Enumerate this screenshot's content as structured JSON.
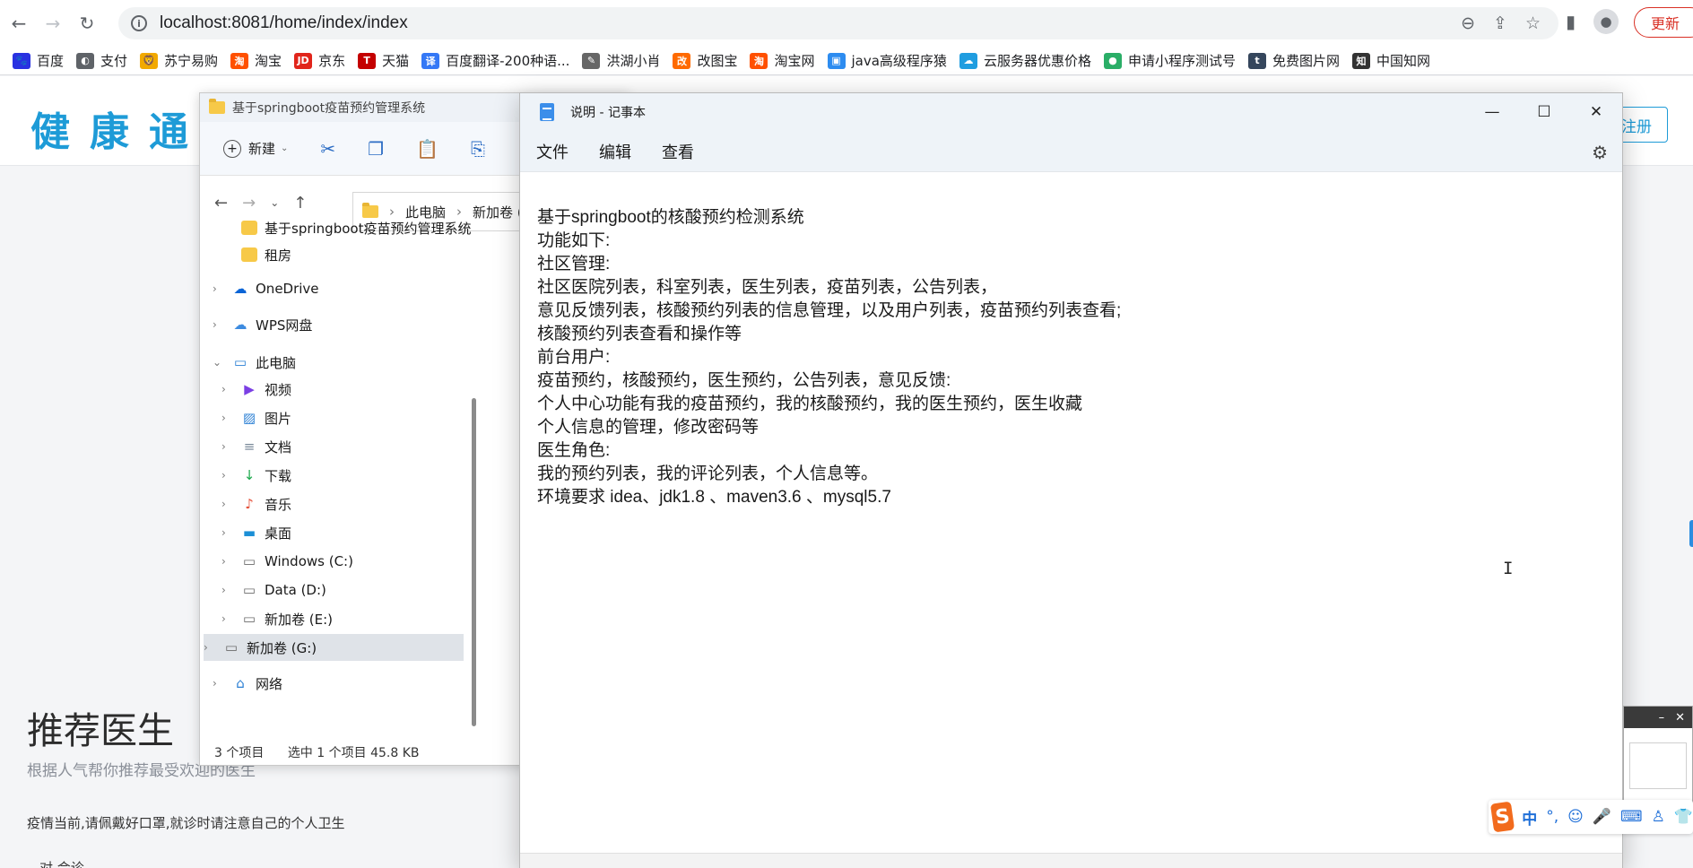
{
  "browser": {
    "url": "localhost:8081/home/index/index",
    "update_label": "更新",
    "bookmarks": [
      {
        "label": "百度",
        "icon": "baidu-icon",
        "color": "#2932e1",
        "glyph": "🐾"
      },
      {
        "label": "支付",
        "icon": "globe-icon",
        "color": "#5f6368",
        "glyph": "◐"
      },
      {
        "label": "苏宁易购",
        "icon": "suning-icon",
        "color": "#f2a900",
        "glyph": "🦁"
      },
      {
        "label": "淘宝",
        "icon": "taobao-icon",
        "color": "#ff5000",
        "glyph": "淘"
      },
      {
        "label": "京东",
        "icon": "jd-icon",
        "color": "#e1251b",
        "glyph": "JD"
      },
      {
        "label": "天猫",
        "icon": "tmall-icon",
        "color": "#c40000",
        "glyph": "T"
      },
      {
        "label": "百度翻译-200种语...",
        "icon": "translate-icon",
        "color": "#3478f6",
        "glyph": "译"
      },
      {
        "label": "洪湖小肖",
        "icon": "feather-icon",
        "color": "#666666",
        "glyph": "✎"
      },
      {
        "label": "改图宝",
        "icon": "gaitubao-icon",
        "color": "#ff6a00",
        "glyph": "改"
      },
      {
        "label": "淘宝网",
        "icon": "taobao-icon",
        "color": "#ff5000",
        "glyph": "淘"
      },
      {
        "label": "java高级程序猿",
        "icon": "tv-icon",
        "color": "#2d8cf0",
        "glyph": "▣"
      },
      {
        "label": "云服务器优惠价格",
        "icon": "cloud-icon",
        "color": "#1f9de0",
        "glyph": "☁"
      },
      {
        "label": "申请小程序测试号",
        "icon": "wechat-icon",
        "color": "#2aae67",
        "glyph": "●"
      },
      {
        "label": "免费图片网",
        "icon": "tumblr-icon",
        "color": "#35465c",
        "glyph": "t"
      },
      {
        "label": "中国知网",
        "icon": "cnki-icon",
        "color": "#333333",
        "glyph": "知"
      }
    ]
  },
  "website": {
    "logo": "健康通",
    "register_label": "注册",
    "recommend_title": "推荐医生",
    "recommend_sub": "根据人气帮你推荐最受欢迎的医生",
    "notice": "疫情当前,请佩戴好口罩,就诊时请注意自己的个人卫生",
    "bottom_fragment": "对  会诊"
  },
  "explorer": {
    "title": "基于springboot疫苗预约管理系统",
    "new_label": "新建",
    "breadcrumb": [
      "此电脑",
      "新加卷 (G"
    ],
    "tree": [
      {
        "label": "基于springboot疫苗预约管理系统",
        "icon": "folder-icon",
        "level": 2,
        "chevron": false
      },
      {
        "label": "租房",
        "icon": "folder-icon",
        "level": 2,
        "chevron": false
      },
      {
        "label": "OneDrive",
        "icon": "onedrive-icon",
        "level": 1,
        "chevron": true
      },
      {
        "label": "WPS网盘",
        "icon": "cloud-icon",
        "level": 1,
        "chevron": true
      },
      {
        "label": "此电脑",
        "icon": "computer-icon",
        "level": 1,
        "chevron": true,
        "expanded": true
      },
      {
        "label": "视频",
        "icon": "video-icon",
        "level": 2,
        "chevron": true
      },
      {
        "label": "图片",
        "icon": "picture-icon",
        "level": 2,
        "chevron": true
      },
      {
        "label": "文档",
        "icon": "document-icon",
        "level": 2,
        "chevron": true
      },
      {
        "label": "下载",
        "icon": "download-icon",
        "level": 2,
        "chevron": true
      },
      {
        "label": "音乐",
        "icon": "music-icon",
        "level": 2,
        "chevron": true
      },
      {
        "label": "桌面",
        "icon": "desktop-icon",
        "level": 2,
        "chevron": true
      },
      {
        "label": "Windows (C:)",
        "icon": "drive-icon",
        "level": 2,
        "chevron": true
      },
      {
        "label": "Data (D:)",
        "icon": "drive-icon",
        "level": 2,
        "chevron": true
      },
      {
        "label": "新加卷 (E:)",
        "icon": "drive-icon",
        "level": 2,
        "chevron": true
      },
      {
        "label": "新加卷 (G:)",
        "icon": "drive-icon",
        "level": 2,
        "chevron": true,
        "selected": true
      },
      {
        "label": "网络",
        "icon": "network-icon",
        "level": 1,
        "chevron": true
      }
    ],
    "status_items": "3 个项目",
    "status_selected": "选中 1 个项目  45.8 KB"
  },
  "notepad": {
    "title": "说明 - 记事本",
    "menu": [
      "文件",
      "编辑",
      "查看"
    ],
    "lines": [
      "基于springboot的核酸预约检测系统",
      "功能如下:",
      "社区管理:",
      "社区医院列表，科室列表，医生列表，疫苗列表，公告列表，",
      "意见反馈列表，核酸预约列表的信息管理，以及用户列表，疫苗预约列表查看;",
      "核酸预约列表查看和操作等",
      "前台用户:",
      "疫苗预约，核酸预约，医生预约，公告列表，意见反馈:",
      "个人中心功能有我的疫苗预约，我的核酸预约，我的医生预约，医生收藏",
      "个人信息的管理，修改密码等",
      "医生角色:",
      "我的预约列表，我的评论列表，个人信息等。",
      "环境要求 idea、jdk1.8 、maven3.6 、mysql5.7"
    ]
  },
  "ime": {
    "label": "中",
    "punct": "°,"
  }
}
